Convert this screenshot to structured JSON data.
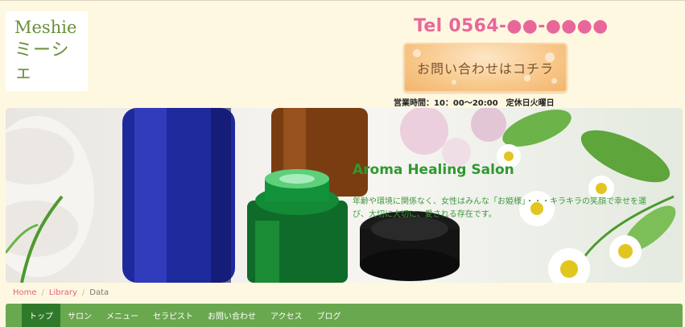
{
  "logo": {
    "line1": "Meshie",
    "line2": "ミーシェ"
  },
  "header": {
    "tel": "Tel 0564-●●-●●●●",
    "contact_button": "お問い合わせはコチラ",
    "hours": "営業時間：10：00〜20:00　定休日火曜日"
  },
  "hero": {
    "title": "Aroma Healing Salon",
    "text": "年齢や環境に関係なく、女性はみんな「お姫様」・・・キラキラの笑顔で幸せを運び、大切に大切に、愛される存在です。"
  },
  "breadcrumb": {
    "items": [
      "Home",
      "Library",
      "Data"
    ],
    "separator": "/"
  },
  "nav": {
    "items": [
      "トップ",
      "サロン",
      "メニュー",
      "セラピスト",
      "お問い合わせ",
      "アクセス",
      "ブログ"
    ]
  },
  "colors": {
    "background": "#fff8e1",
    "accent_pink": "#e8679a",
    "nav_green": "#6aa84f",
    "nav_active": "#2f7a2a",
    "hero_text_green": "#2e9a2e"
  }
}
